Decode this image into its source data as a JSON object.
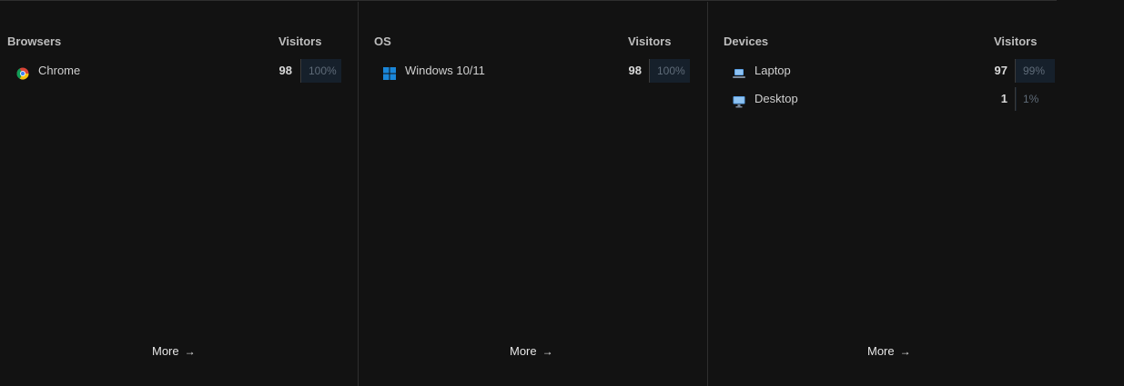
{
  "panels": [
    {
      "title": "Browsers",
      "metric_label": "Visitors",
      "rows": [
        {
          "icon": "chrome-icon",
          "label": "Chrome",
          "count": "98",
          "percent_text": "100%",
          "percent": 100
        }
      ],
      "more_label": "More"
    },
    {
      "title": "OS",
      "metric_label": "Visitors",
      "rows": [
        {
          "icon": "windows-icon",
          "label": "Windows 10/11",
          "count": "98",
          "percent_text": "100%",
          "percent": 100
        }
      ],
      "more_label": "More"
    },
    {
      "title": "Devices",
      "metric_label": "Visitors",
      "rows": [
        {
          "icon": "laptop-icon",
          "label": "Laptop",
          "count": "97",
          "percent_text": "99%",
          "percent": 99
        },
        {
          "icon": "desktop-icon",
          "label": "Desktop",
          "count": "1",
          "percent_text": "1%",
          "percent": 1
        }
      ],
      "more_label": "More"
    }
  ],
  "colors": {
    "background": "#121212",
    "divider": "#2e2e2e",
    "percent_bar": "#16202b",
    "windows_blue": "#1a86d9",
    "device_blue": "#5aa0e6"
  }
}
